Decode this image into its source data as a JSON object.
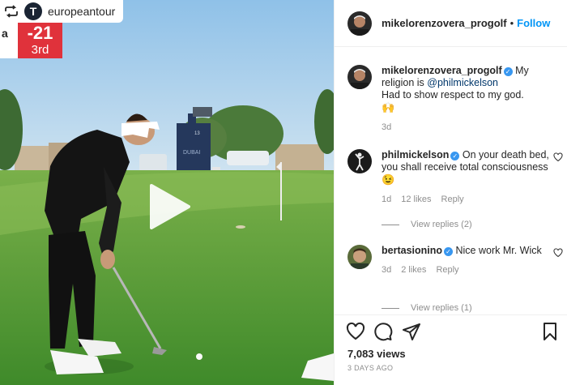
{
  "media": {
    "repost_user": "europeantour",
    "repost_avatar_letter": "T",
    "score_prefix": "a",
    "score_value": "-21",
    "score_position": "3rd",
    "board_text": "DUBAI",
    "board_number": "13"
  },
  "header": {
    "username": "mikelorenzovera_progolf",
    "separator": "•",
    "follow_label": "Follow"
  },
  "caption": {
    "username": "mikelorenzovera_progolf",
    "text_before": "My religion is ",
    "mention": "@philmickelson",
    "text_after": "Had to show respect to my god.",
    "emoji": "🙌",
    "time": "3d"
  },
  "comments": [
    {
      "username": "philmickelson",
      "text": "On your death bed, you shall receive total consciousness",
      "emoji": "😉",
      "time": "1d",
      "likes": "12 likes",
      "reply_label": "Reply",
      "view_replies": "View replies (2)"
    },
    {
      "username": "bertasionino",
      "text": "Nice work Mr. Wick",
      "time": "3d",
      "likes": "2 likes",
      "reply_label": "Reply",
      "view_replies": "View replies (1)"
    }
  ],
  "footer": {
    "views": "7,083 views",
    "date": "3 DAYS AGO"
  },
  "colors": {
    "follow": "#0095f6",
    "verified": "#3897f0",
    "score_red": "#e0323b"
  },
  "icons": [
    "repost-icon",
    "play-icon",
    "verified-icon",
    "heart-icon",
    "comment-icon",
    "share-icon",
    "bookmark-icon"
  ]
}
